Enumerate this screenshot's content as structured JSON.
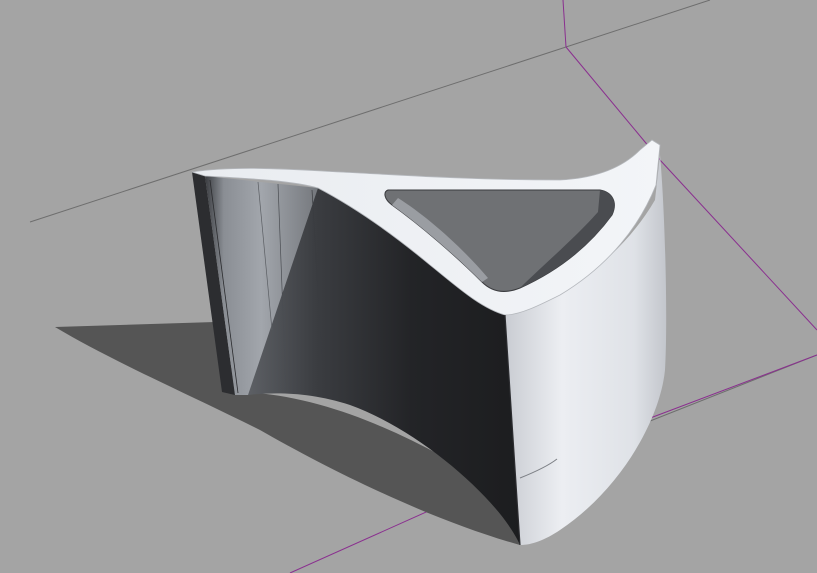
{
  "scene": {
    "background_color": "#a4a4a4",
    "ground_line_color": "#6e6e6e",
    "axis_line_color": "#8a2f8f",
    "shadow_color": "#555555",
    "model": {
      "kind": "extruded-profile",
      "light_face_color": "#e6e9ee",
      "mid_face_color": "#8e9399",
      "dark_face_color": "#2a2b2e",
      "hole_color": "#6f7174"
    }
  }
}
